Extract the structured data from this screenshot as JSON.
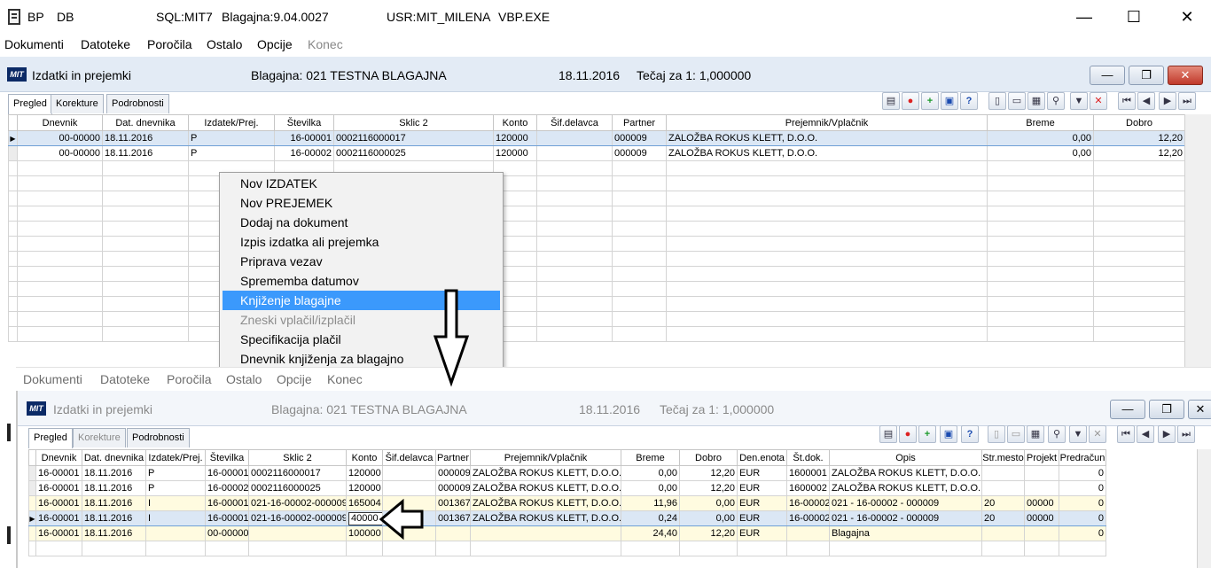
{
  "titlebar": {
    "icon": "notebook-icon",
    "parts": [
      "BP",
      "DB",
      "SQL:MIT7",
      "Blagajna:9.04.0027",
      "USR:MIT_MILENA",
      "VBP.EXE"
    ],
    "minimize": "—",
    "maximize": "☐",
    "close": "✕"
  },
  "menubar": [
    "Dokumenti",
    "Datoteke",
    "Poročila",
    "Ostalo",
    "Opcije",
    "Konec"
  ],
  "window1": {
    "logo": "MIT",
    "title": "Izdatki in prejemki",
    "blagajna": "Blagajna: 021  TESTNA BLAGAJNA",
    "date": "18.11.2016",
    "tecaj": "Tečaj za 1: 1,000000",
    "tabs": [
      "Pregled",
      "Korekture",
      "Podrobnosti"
    ],
    "columns": [
      "Dnevnik",
      "Dat. dnevnika",
      "Izdatek/Prej.",
      "Številka",
      "Sklic 2",
      "Konto",
      "Šif.delavca",
      "Partner",
      "Prejemnik/Vplačnik",
      "Breme",
      "Dobro"
    ],
    "rows": [
      [
        "00-00000",
        "18.11.2016",
        "P",
        "16-00001",
        "0002116000017",
        "120000",
        "",
        "000009",
        "ZALOŽBA ROKUS KLETT, D.O.O.",
        "0,00",
        "12,20"
      ],
      [
        "00-00000",
        "18.11.2016",
        "P",
        "16-00002",
        "0002116000025",
        "120000",
        "",
        "000009",
        "ZALOŽBA ROKUS KLETT, D.O.O.",
        "0,00",
        "12,20"
      ]
    ],
    "row_marker": "▶"
  },
  "context_menu": {
    "items": [
      "Nov IZDATEK",
      "Nov PREJEMEK",
      "Dodaj na dokument",
      "Izpis izdatka ali prejemka",
      "Priprava vezav",
      "Sprememba datumov",
      "Knjiženje blagajne",
      "Zneski vplačil/izplačil",
      "Specifikacija plačil",
      "Dnevnik knjiženja za blagajno"
    ],
    "highlighted": "Knjiženje blagajne",
    "disabled": "Zneski vplačil/izplačil"
  },
  "menubar2": [
    "Dokumenti",
    "Datoteke",
    "Poročila",
    "Ostalo",
    "Opcije",
    "Konec"
  ],
  "window2": {
    "logo": "MIT",
    "title": "Izdatki in prejemki",
    "blagajna": "Blagajna: 021  TESTNA BLAGAJNA",
    "date": "18.11.2016",
    "tecaj": "Tečaj za 1: 1,000000",
    "tabs": [
      "Pregled",
      "Korekture",
      "Podrobnosti"
    ],
    "columns": [
      "Dnevnik",
      "Dat. dnevnika",
      "Izdatek/Prej.",
      "Številka",
      "Sklic 2",
      "Konto",
      "Šif.delavca",
      "Partner",
      "Prejemnik/Vplačnik",
      "Breme",
      "Dobro",
      "Den.enota",
      "Št.dok.",
      "Opis",
      "Str.mesto",
      "Projekt",
      "Predračun"
    ],
    "rows": [
      [
        "16-00001",
        "18.11.2016",
        "P",
        "16-00001",
        "0002116000017",
        "120000",
        "",
        "000009",
        "ZALOŽBA ROKUS KLETT, D.O.O.",
        "0,00",
        "12,20",
        "EUR",
        "1600001",
        "ZALOŽBA ROKUS KLETT, D.O.O.",
        "",
        "",
        "0"
      ],
      [
        "16-00001",
        "18.11.2016",
        "P",
        "16-00002",
        "0002116000025",
        "120000",
        "",
        "000009",
        "ZALOŽBA ROKUS KLETT, D.O.O.",
        "0,00",
        "12,20",
        "EUR",
        "1600002",
        "ZALOŽBA ROKUS KLETT, D.O.O.",
        "",
        "",
        "0"
      ],
      [
        "16-00001",
        "18.11.2016",
        "I",
        "16-00001",
        "021-16-00002-000009",
        "165004",
        "",
        "001367",
        "ZALOŽBA ROKUS KLETT, D.O.O.",
        "11,96",
        "0,00",
        "EUR",
        "16-00002",
        "021 - 16-00002 - 000009",
        "20",
        "00000",
        "0"
      ],
      [
        "16-00001",
        "18.11.2016",
        "I",
        "16-00001",
        "021-16-00002-000009",
        "40000",
        "",
        "001367",
        "ZALOŽBA ROKUS KLETT, D.O.O.",
        "0,24",
        "0,00",
        "EUR",
        "16-00002",
        "021 - 16-00002 - 000009",
        "20",
        "00000",
        "0"
      ],
      [
        "16-00001",
        "18.11.2016",
        "",
        "00-00000",
        "",
        "100000",
        "",
        "",
        "",
        "24,40",
        "12,20",
        "EUR",
        "",
        "Blagajna",
        "",
        "",
        "0"
      ]
    ],
    "row_marker": "▶"
  }
}
